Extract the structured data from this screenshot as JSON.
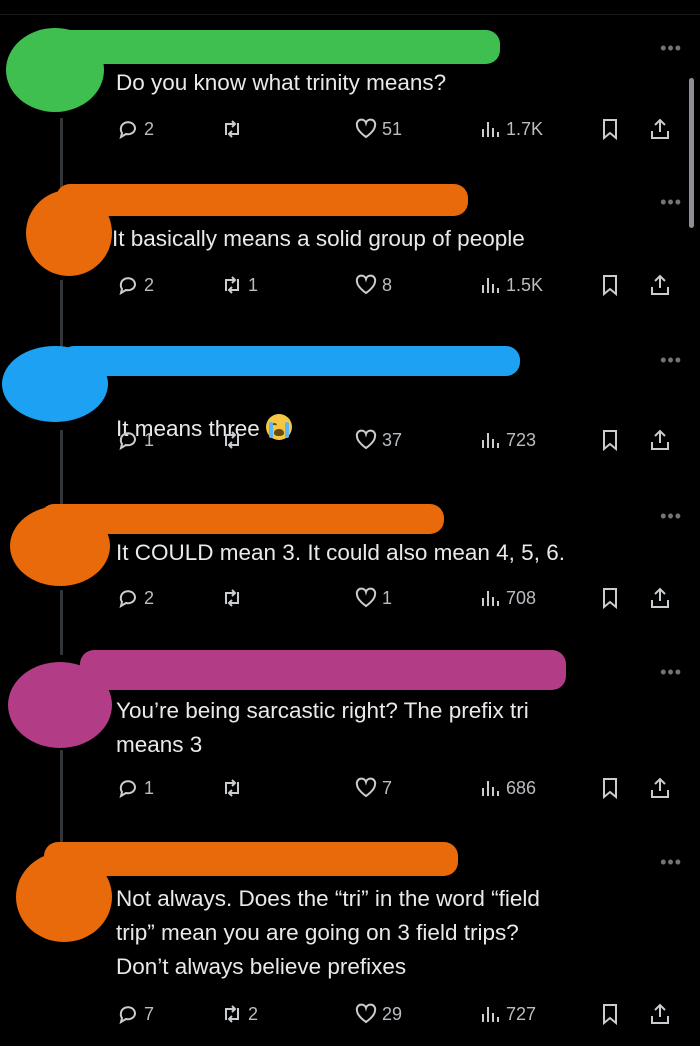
{
  "colors": {
    "green": "#3fbf4f",
    "orange": "#e86a0b",
    "blue": "#1da1f2",
    "magenta": "#b23c86"
  },
  "icons": {
    "reply": "reply-icon",
    "retweet": "retweet-icon",
    "like": "heart-icon",
    "views": "views-icon",
    "bookmark": "bookmark-icon",
    "share": "share-icon",
    "more": "more-icon"
  },
  "more_label": "•••",
  "tweets": [
    {
      "text": "Do you know what trinity means?",
      "replies": "2",
      "retweets": "",
      "likes": "51",
      "views": "1.7K"
    },
    {
      "text": "It basically means a solid group of people",
      "replies": "2",
      "retweets": "1",
      "likes": "8",
      "views": "1.5K"
    },
    {
      "text": "It means three",
      "emoji": "crying-face-emoji",
      "replies": "1",
      "retweets": "",
      "likes": "37",
      "views": "723"
    },
    {
      "text": "It COULD mean 3. It could also mean 4, 5, 6.",
      "replies": "2",
      "retweets": "",
      "likes": "1",
      "views": "708"
    },
    {
      "text": "You’re being sarcastic right? The prefix tri\nmeans 3",
      "replies": "1",
      "retweets": "",
      "likes": "7",
      "views": "686"
    },
    {
      "text": "Not always. Does the “tri” in the word “field\ntrip” mean you are going on 3 field trips?\nDon’t always believe prefixes",
      "replies": "7",
      "retweets": "2",
      "likes": "29",
      "views": "727"
    }
  ]
}
